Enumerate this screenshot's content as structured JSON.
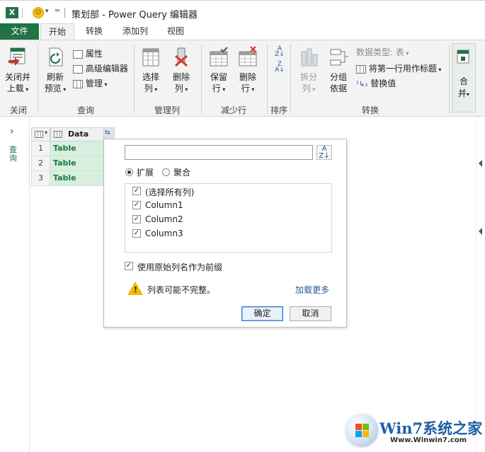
{
  "title_bar": {
    "app_logo": "X",
    "title": "策划部 - Power Query 编辑器"
  },
  "tabs": [
    {
      "label": "文件"
    },
    {
      "label": "开始"
    },
    {
      "label": "转换"
    },
    {
      "label": "添加列"
    },
    {
      "label": "视图"
    }
  ],
  "ribbon": {
    "close_group": {
      "line1": "关闭并",
      "line2": "上载",
      "group_label": "关闭"
    },
    "query_group": {
      "refresh_line1": "刷新",
      "refresh_line2": "预览",
      "properties": "属性",
      "advanced_editor": "高级编辑器",
      "manage": "管理",
      "group_label": "查询"
    },
    "manage_columns_group": {
      "choose_line1": "选择",
      "choose_line2": "列",
      "remove_line1": "删除",
      "remove_line2": "列",
      "group_label": "管理列"
    },
    "reduce_rows_group": {
      "keep_line1": "保留",
      "keep_line2": "行",
      "remove_line1": "删除",
      "remove_line2": "行",
      "group_label": "减少行"
    },
    "sort_group": {
      "group_label": "排序"
    },
    "transform_group": {
      "split_line1": "拆分",
      "split_line2": "列",
      "groupby_line1": "分组",
      "groupby_line2": "依据",
      "data_type": "数据类型: 表",
      "first_row_header": "将第一行用作标题",
      "replace_values": "替换值",
      "group_label": "转换"
    },
    "combine_group": {
      "line1": "合",
      "line2": "并"
    }
  },
  "left_nav": {
    "label": "查询"
  },
  "grid": {
    "column_header": "Data",
    "rows": [
      {
        "num": "1",
        "value": "Table"
      },
      {
        "num": "2",
        "value": "Table"
      },
      {
        "num": "3",
        "value": "Table"
      }
    ]
  },
  "expand_panel": {
    "search_value": "",
    "radio_expand": "扩展",
    "radio_aggregate": "聚合",
    "columns": [
      {
        "label": "(选择所有列)",
        "checked": true
      },
      {
        "label": "Column1",
        "checked": true
      },
      {
        "label": "Column2",
        "checked": true
      },
      {
        "label": "Column3",
        "checked": true
      }
    ],
    "prefix_option": "使用原始列名作为前缀",
    "warning": "列表可能不完整。",
    "load_more": "加载更多",
    "ok": "确定",
    "cancel": "取消"
  },
  "watermark": {
    "brand": "Win7系统之家",
    "url": "Www.Winwin7.com"
  },
  "colors": {
    "accent": "#217346",
    "table_cell_bg": "#d9efe0",
    "table_cell_text": "#1a7a3d",
    "link": "#2b5797"
  }
}
